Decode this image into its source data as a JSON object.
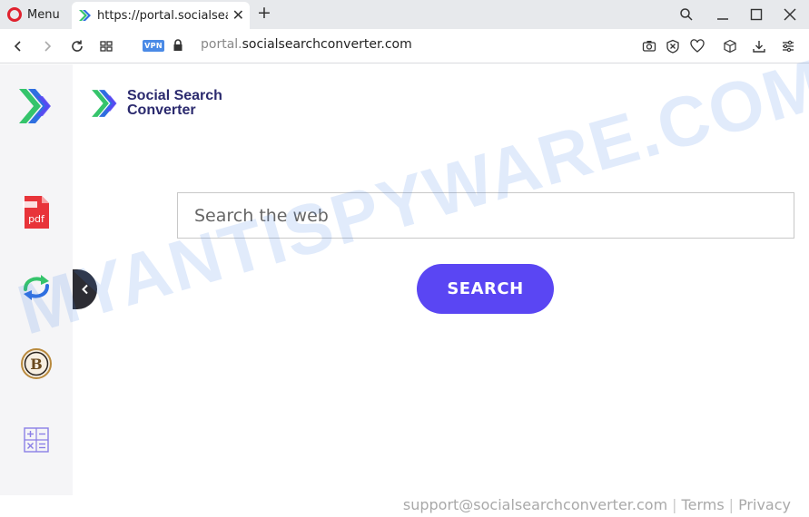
{
  "browser": {
    "menu_label": "Menu",
    "tab_title": "https://portal.socialsearchconverter.com",
    "address": {
      "vpn_label": "VPN",
      "url_prefix": "portal.",
      "url_domain": "socialsearchconverter.com"
    }
  },
  "brand": {
    "line1": "Social Search",
    "line2": "Converter",
    "colors": {
      "text": "#2b2a6e",
      "green": "#35c46b",
      "blue": "#2f6fe0",
      "purple": "#5a46f3"
    }
  },
  "search": {
    "placeholder": "Search the web",
    "value": "",
    "button_label": "SEARCH"
  },
  "sidebar": {
    "items": [
      {
        "name": "logo",
        "icon": "brand-chevron-icon"
      },
      {
        "name": "pdf",
        "icon": "pdf-icon",
        "label": "pdf"
      },
      {
        "name": "converter",
        "icon": "swap-arrows-icon"
      },
      {
        "name": "bitcoin",
        "icon": "bitcoin-icon",
        "label": "B"
      },
      {
        "name": "calculator",
        "icon": "calculator-icon"
      }
    ]
  },
  "watermark": "MYANTISPYWARE.COM",
  "footer": {
    "email": "support@socialsearchconverter.com",
    "terms": "Terms",
    "privacy": "Privacy"
  }
}
